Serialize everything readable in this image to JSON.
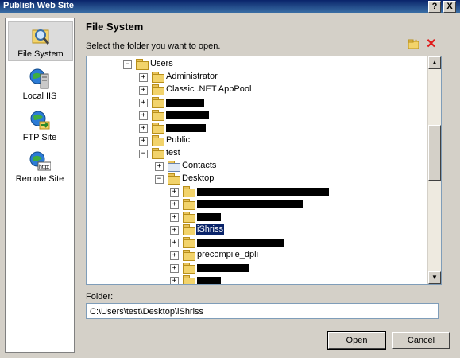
{
  "window": {
    "title": "Publish Web Site",
    "help_label": "?",
    "close_label": "X"
  },
  "nav": [
    {
      "label": "File System",
      "icon": "file-system-icon",
      "selected": true
    },
    {
      "label": "Local IIS",
      "icon": "local-iis-icon"
    },
    {
      "label": "FTP Site",
      "icon": "ftp-site-icon"
    },
    {
      "label": "Remote Site",
      "icon": "remote-site-icon",
      "icon_text": "http:"
    }
  ],
  "header": {
    "title": "File System",
    "subtitle": "Select the folder you want to open."
  },
  "tree": {
    "rows": [
      {
        "label": "Users",
        "expanded": true,
        "depth": 0
      },
      {
        "label": "Administrator",
        "depth": 1
      },
      {
        "label": "Classic .NET AppPool",
        "depth": 1
      },
      {
        "label": "",
        "depth": 1,
        "redacted": true
      },
      {
        "label": "",
        "depth": 1,
        "redacted": true
      },
      {
        "label": "",
        "depth": 1,
        "redacted": true
      },
      {
        "label": "Public",
        "depth": 1
      },
      {
        "label": "test",
        "expanded": true,
        "depth": 1
      },
      {
        "label": "Contacts",
        "depth": 2,
        "special": true
      },
      {
        "label": "Desktop",
        "expanded": true,
        "depth": 2
      },
      {
        "label": "",
        "depth": 3,
        "redacted": true
      },
      {
        "label": "",
        "depth": 3,
        "redacted": true
      },
      {
        "label": "",
        "depth": 3,
        "redacted": true
      },
      {
        "label": "iShriss",
        "depth": 3,
        "selected": true
      },
      {
        "label": "",
        "depth": 3,
        "redacted": true
      },
      {
        "label": "precompile_dpli",
        "depth": 3
      },
      {
        "label": "",
        "depth": 3,
        "redacted": true
      },
      {
        "label": "",
        "depth": 3,
        "redacted": true
      }
    ]
  },
  "folder": {
    "label": "Folder:",
    "value": "C:\\Users\\test\\Desktop\\iShriss"
  },
  "buttons": {
    "open": "Open",
    "cancel": "Cancel"
  },
  "colors": {
    "selection": "#0a246a",
    "titlebar": "#0a246a",
    "delete": "#e01b1b"
  }
}
